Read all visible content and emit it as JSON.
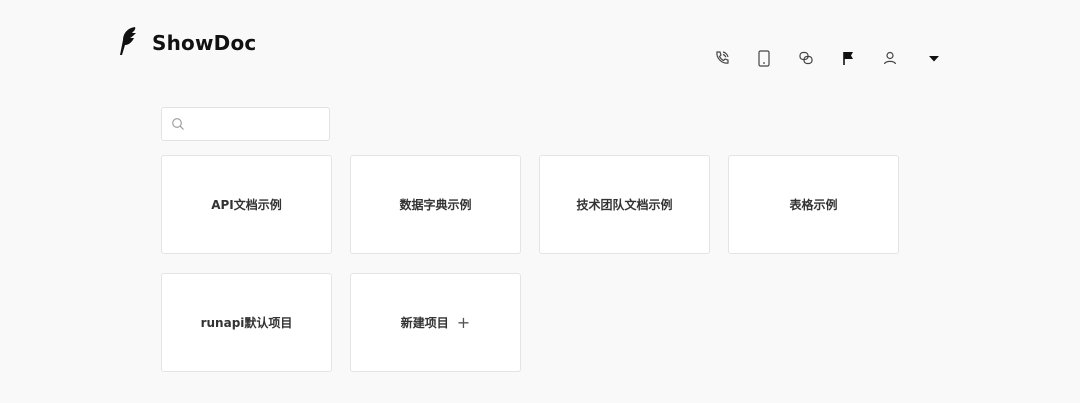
{
  "header": {
    "app_name": "ShowDoc",
    "toolbar_icons": [
      "support-icon",
      "mobile-icon",
      "link-icon",
      "flag-icon",
      "user-icon",
      "caret-down-icon"
    ]
  },
  "search": {
    "placeholder": "",
    "value": ""
  },
  "projects": [
    {
      "label": "API文档示例"
    },
    {
      "label": "数据字典示例"
    },
    {
      "label": "技术团队文档示例"
    },
    {
      "label": "表格示例"
    },
    {
      "label": "runapi默认项目"
    }
  ],
  "new_project": {
    "label": "新建项目",
    "plus": "+"
  },
  "colors": {
    "background": "#f9f9f9",
    "card": "#ffffff",
    "border": "#e4e4e4",
    "text": "#333333"
  }
}
